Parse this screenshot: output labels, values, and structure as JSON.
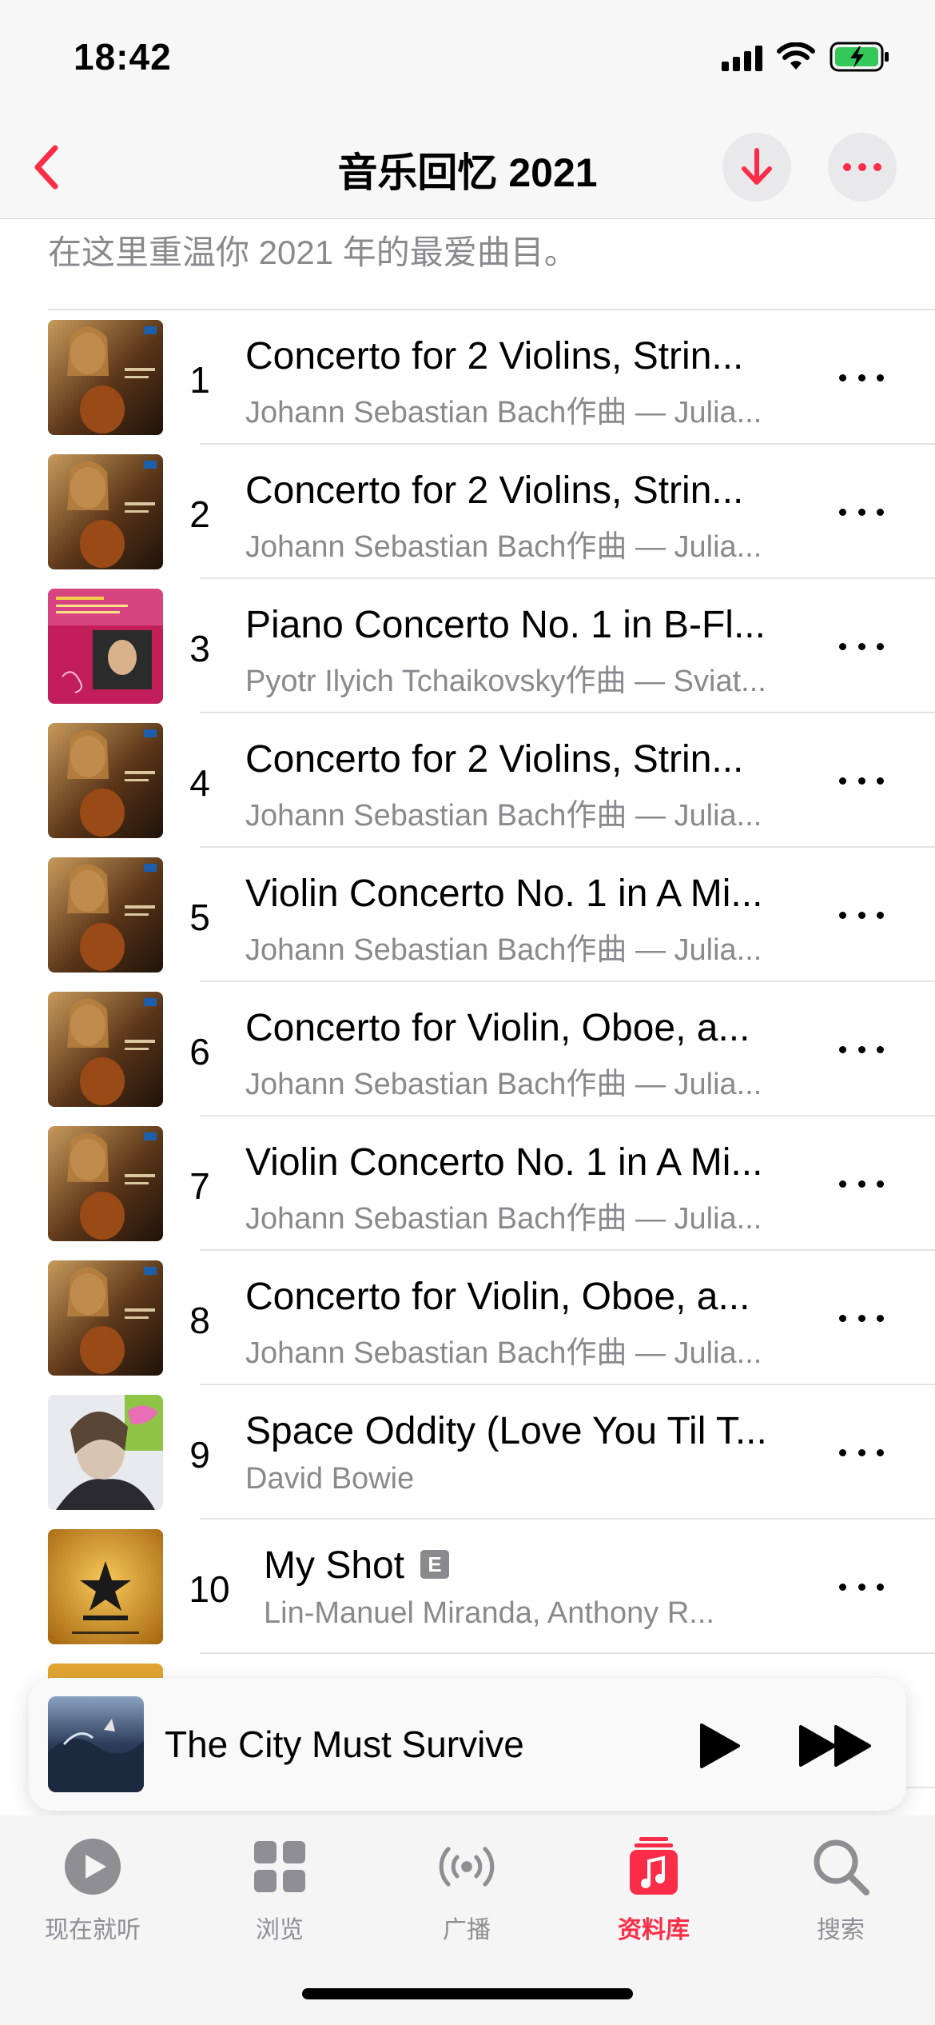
{
  "status_bar": {
    "time": "18:42"
  },
  "nav": {
    "title": "音乐回忆 2021"
  },
  "playlist": {
    "description": "在这里重温你 2021 年的最爱曲目。"
  },
  "tracks": [
    {
      "number": "1",
      "title": "Concerto for 2 Violins, Strin...",
      "subtitle": "Johann Sebastian Bach作曲 — Julia...",
      "artwork": "julia-fischer-bach-concertos",
      "explicit": false
    },
    {
      "number": "2",
      "title": "Concerto for 2 Violins, Strin...",
      "subtitle": "Johann Sebastian Bach作曲 — Julia...",
      "artwork": "julia-fischer-bach-concertos",
      "explicit": false
    },
    {
      "number": "3",
      "title": "Piano Concerto No. 1 in B-Fl...",
      "subtitle": "Pyotr Ilyich Tchaikovsky作曲 — Sviat...",
      "artwork": "richter-tchaikovsky",
      "explicit": false
    },
    {
      "number": "4",
      "title": "Concerto for 2 Violins, Strin...",
      "subtitle": "Johann Sebastian Bach作曲 — Julia...",
      "artwork": "julia-fischer-bach-concertos",
      "explicit": false
    },
    {
      "number": "5",
      "title": "Violin Concerto No. 1 in A Mi...",
      "subtitle": "Johann Sebastian Bach作曲 — Julia...",
      "artwork": "julia-fischer-bach-concertos",
      "explicit": false
    },
    {
      "number": "6",
      "title": "Concerto for Violin, Oboe, a...",
      "subtitle": "Johann Sebastian Bach作曲 — Julia...",
      "artwork": "julia-fischer-bach-concertos",
      "explicit": false
    },
    {
      "number": "7",
      "title": "Violin Concerto No. 1 in A Mi...",
      "subtitle": "Johann Sebastian Bach作曲 — Julia...",
      "artwork": "julia-fischer-bach-concertos",
      "explicit": false
    },
    {
      "number": "8",
      "title": "Concerto for Violin, Oboe, a...",
      "subtitle": "Johann Sebastian Bach作曲 — Julia...",
      "artwork": "julia-fischer-bach-concertos",
      "explicit": false
    },
    {
      "number": "9",
      "title": "Space Oddity (Love You Til T...",
      "subtitle": "David Bowie",
      "artwork": "david-bowie-portrait",
      "explicit": false
    },
    {
      "number": "10",
      "title": "My Shot",
      "subtitle": "Lin-Manuel Miranda, Anthony R...",
      "artwork": "hamilton",
      "explicit": true,
      "explicit_label": "E"
    }
  ],
  "mini_player": {
    "title": "The City Must Survive",
    "artwork": "stormy-sea"
  },
  "tabs": [
    {
      "label": "现在就听",
      "icon": "play-circle-icon",
      "active": false
    },
    {
      "label": "浏览",
      "icon": "grid-icon",
      "active": false
    },
    {
      "label": "广播",
      "icon": "radio-icon",
      "active": false
    },
    {
      "label": "资料库",
      "icon": "music-library-icon",
      "active": true
    },
    {
      "label": "搜索",
      "icon": "search-icon",
      "active": false
    }
  ],
  "colors": {
    "accent": "#fa2d48",
    "secondary_text": "#8a8a8e",
    "tab_inactive": "#8e8e93",
    "battery_green": "#34c759"
  }
}
